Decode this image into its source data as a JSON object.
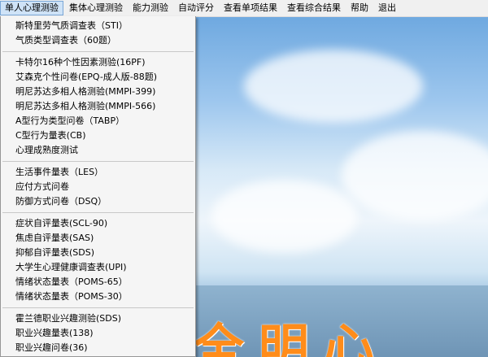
{
  "menubar": {
    "items": [
      {
        "label": "单人心理测验",
        "active": true
      },
      {
        "label": "集体心理测验",
        "active": false
      },
      {
        "label": "能力测验",
        "active": false
      },
      {
        "label": "自动评分",
        "active": false
      },
      {
        "label": "查看单项结果",
        "active": false
      },
      {
        "label": "查看综合结果",
        "active": false
      },
      {
        "label": "帮助",
        "active": false
      },
      {
        "label": "退出",
        "active": false
      }
    ]
  },
  "dropdown": {
    "groups": [
      [
        "斯特里劳气质调查表（STI）",
        "气质类型调查表（60题）"
      ],
      [
        "卡特尔16种个性因素测验(16PF)",
        "艾森克个性问卷(EPQ-成人版-88题)",
        "明尼苏达多相人格测验(MMPI-399)",
        "明尼苏达多相人格测验(MMPI-566)",
        "A型行为类型问卷（TABP）",
        "C型行为量表(CB)",
        "心理成熟度测试"
      ],
      [
        "生活事件量表（LES）",
        "应付方式问卷",
        "防御方式问卷（DSQ）"
      ],
      [
        "症状自评量表(SCL-90)",
        "焦虑自评量表(SAS)",
        "抑郁自评量表(SDS)",
        "大学生心理健康调查表(UPI)",
        "情绪状态量表（POMS-65）",
        "情绪状态量表（POMS-30）"
      ],
      [
        "霍兰德职业兴趣测验(SDS)",
        "职业兴趣量表(138)",
        "职业兴趣问卷(36)"
      ]
    ]
  },
  "background": {
    "text": "全明心",
    "text_color": "#ff8c1a"
  }
}
